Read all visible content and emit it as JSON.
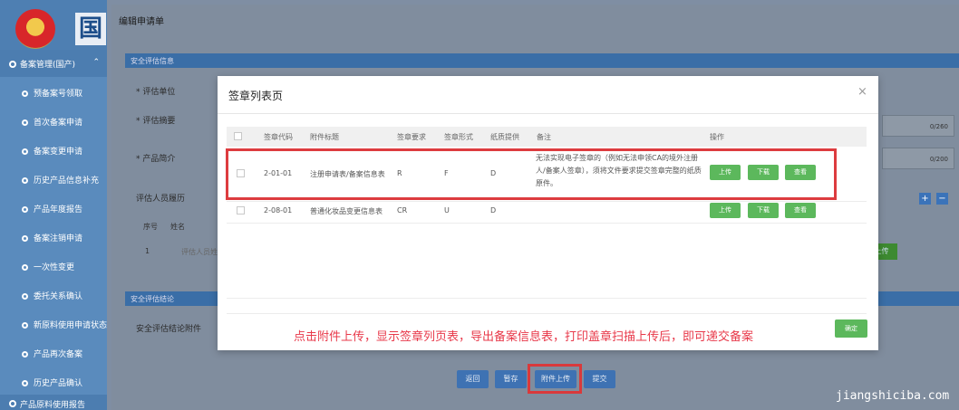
{
  "sidebar": {
    "logo_char": "国",
    "header": "备案管理(国产)",
    "items": [
      {
        "label": "预备案号领取"
      },
      {
        "label": "首次备案申请"
      },
      {
        "label": "备案变更申请"
      },
      {
        "label": "历史产品信息补充"
      },
      {
        "label": "产品年度报告"
      },
      {
        "label": "备案注销申请"
      },
      {
        "label": "一次性变更"
      },
      {
        "label": "委托关系确认"
      },
      {
        "label": "新原料使用申请状态"
      },
      {
        "label": "产品再次备案"
      },
      {
        "label": "历史产品确认"
      }
    ],
    "bottom_label": "产品原料使用报告"
  },
  "main": {
    "title": "编辑申请单",
    "section1": "安全评估信息",
    "field_unit": "* 评估单位",
    "field_summary": "* 评估摘要",
    "field_intro": "* 产品简介",
    "field_people": "评估人员履历",
    "counter1": "0/260",
    "counter2": "0/200",
    "people_col_no": "序号",
    "people_col_name": "姓名",
    "people_row_no": "1",
    "people_row_name": "评估人员姓名",
    "bg_green_btn": "上传",
    "section2": "安全评估结论",
    "field_attach": "安全评估结论附件",
    "buttons": {
      "back": "返回",
      "save": "暂存",
      "attach": "附件上传",
      "submit": "提交"
    }
  },
  "modal": {
    "title": "签章列表页",
    "close": "×",
    "headers": {
      "code": "签章代码",
      "title": "附件标题",
      "req": "签章要求",
      "form": "签章形式",
      "paper": "纸质提供",
      "remark": "备注",
      "action": "操作"
    },
    "rows": [
      {
        "code": "2-01-01",
        "title": "注册申请表/备案信息表",
        "req": "R",
        "form": "F",
        "paper": "D",
        "remark": "无法实现电子签章的（例如无法申领CA的境外注册人/备案人签章），须将文件要求提交签章完整的纸质原件。"
      },
      {
        "code": "2-08-01",
        "title": "普通化妆品变更信息表",
        "req": "CR",
        "form": "U",
        "paper": "D",
        "remark": ""
      }
    ],
    "btn_upload": "上传",
    "btn_download": "下载",
    "btn_view": "查看",
    "confirm": "确定",
    "annotation": "点击附件上传，显示签章列页表，导出备案信息表，打印盖章扫描上传后，即可递交备案"
  },
  "watermark": "jiangshiciba.com",
  "colors": {
    "sidebar": "#5a8bbd",
    "section_bar": "#3a6ea7",
    "green_button": "#5cb85c",
    "highlight_red": "#dd3c3f",
    "annotation_red": "#e8394a"
  }
}
